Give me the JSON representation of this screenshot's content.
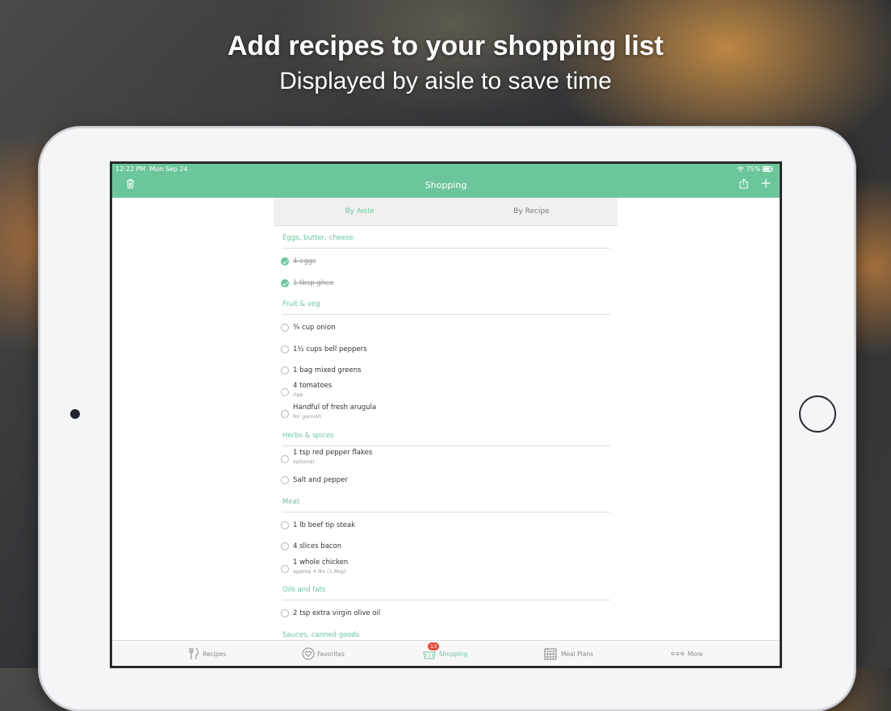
{
  "marketing": {
    "headline": "Add recipes to your shopping list",
    "subline": "Displayed by aisle to save time"
  },
  "status_bar": {
    "time": "12:22 PM",
    "date": "Mon Sep 24",
    "battery": "75%"
  },
  "navbar": {
    "title": "Shopping",
    "left_icon": "trash-icon",
    "right_icons": [
      "share-icon",
      "plus-icon"
    ],
    "color": "#6cc69c"
  },
  "segments": {
    "by_aisle": "By Aisle",
    "by_recipe": "By Recipe",
    "selected": "By Aisle"
  },
  "sections": [
    {
      "title": "Eggs, butter, cheese",
      "items": [
        {
          "text": "4 eggs",
          "note": "",
          "checked": true
        },
        {
          "text": "1 tbsp ghee",
          "note": "",
          "checked": true
        }
      ]
    },
    {
      "title": "Fruit & veg",
      "items": [
        {
          "text": "¾ cup onion",
          "note": "",
          "checked": false
        },
        {
          "text": "1½ cups bell peppers",
          "note": "",
          "checked": false
        },
        {
          "text": "1 bag mixed greens",
          "note": "",
          "checked": false
        },
        {
          "text": "4 tomatoes",
          "note": "ripe",
          "checked": false
        },
        {
          "text": "Handful of fresh arugula",
          "note": "for garnish",
          "checked": false
        }
      ]
    },
    {
      "title": "Herbs & spices",
      "items": [
        {
          "text": "1 tsp red pepper flakes",
          "note": "optional",
          "checked": false
        },
        {
          "text": "Salt and pepper",
          "note": "",
          "checked": false
        }
      ]
    },
    {
      "title": "Meat",
      "items": [
        {
          "text": "1 lb beef tip steak",
          "note": "",
          "checked": false
        },
        {
          "text": "4 slices bacon",
          "note": "",
          "checked": false
        },
        {
          "text": "1 whole chicken",
          "note": "approx 4 lbs (1.8kg)",
          "checked": false
        }
      ]
    },
    {
      "title": "Oils and fats",
      "items": [
        {
          "text": "2 tsp extra virgin olive oil",
          "note": "",
          "checked": false
        }
      ]
    },
    {
      "title": "Sauces, canned goods",
      "items": []
    }
  ],
  "tabbar": {
    "recipes": "Recipes",
    "favorites": "Favorites",
    "shopping": "Shopping",
    "shopping_badge": "13",
    "meal_plans": "Meal Plans",
    "more": "More",
    "active": "Shopping"
  }
}
